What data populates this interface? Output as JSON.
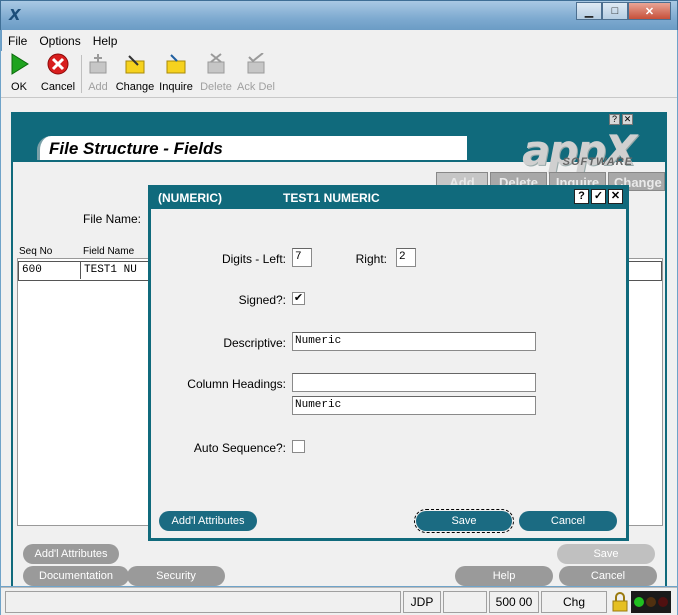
{
  "window": {
    "app_icon": "X",
    "controls": {
      "minimize": "▁",
      "maximize": "□",
      "close": "✕"
    }
  },
  "menu": [
    "File",
    "Options",
    "Help"
  ],
  "toolbar": {
    "ok": "OK",
    "cancel": "Cancel",
    "add": "Add",
    "change": "Change",
    "inquire": "Inquire",
    "delete": "Delete",
    "ack_del": "Ack Del"
  },
  "inner": {
    "controls": {
      "help": "?",
      "close": "✕"
    },
    "title": "File Structure - Fields",
    "logo": {
      "main": "appX",
      "sub": "SOFTWARE"
    },
    "action_tabs": [
      "Add",
      "Delete",
      "Inquire",
      "Change"
    ],
    "file_name_label": "File Name:",
    "columns": {
      "seq_no": "Seq No",
      "field_name": "Field Name"
    },
    "row": {
      "seq": "600",
      "name": "TEST1 NU"
    },
    "buttons": {
      "addl_attributes": "Add'l Attributes",
      "documentation": "Documentation",
      "security": "Security",
      "save": "Save",
      "help": "Help",
      "cancel": "Cancel"
    }
  },
  "status": {
    "user": "JDP",
    "value": "500 00",
    "mode": "Chg"
  },
  "dialog": {
    "title_left": "(NUMERIC)",
    "title_right": "TEST1 NUMERIC",
    "controls": {
      "help": "?",
      "ok": "✓",
      "close": "✕"
    },
    "labels": {
      "digits_left": "Digits - Left:",
      "right": "Right:",
      "signed": "Signed?:",
      "descriptive": "Descriptive:",
      "column_headings": "Column Headings:",
      "auto_sequence": "Auto Sequence?:"
    },
    "values": {
      "digits_left": "7",
      "right": "2",
      "signed_mark": "✔",
      "descriptive": "Numeric",
      "heading_1": "",
      "heading_2": "Numeric"
    },
    "buttons": {
      "addl_attributes": "Add'l Attributes",
      "save": "Save",
      "cancel": "Cancel"
    }
  },
  "colors": {
    "teal": "#106a7c",
    "dialog_button": "#1b6b82",
    "gray_button": "#9a9a9a"
  }
}
